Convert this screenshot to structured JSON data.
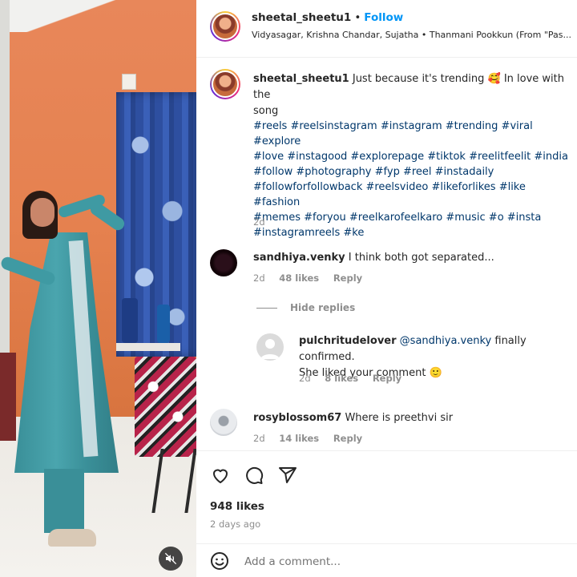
{
  "post": {
    "author": "sheetal_sheetu1",
    "follow_label": "Follow",
    "audio": "Vidyasagar, Krishna Chandar, Sujatha • Thanmani Pookkun (From \"Pas..."
  },
  "caption": {
    "username": "sheetal_sheetu1",
    "text_line1": "Just because it's trending 🥰 In love with the",
    "text_line2": "song",
    "hashtags": [
      "#reels #reelsinstagram #instagram #trending #viral #explore",
      "#love #instagood #explorepage #tiktok #reelitfeelit #india",
      "#follow #photography #fyp #reel #instadaily",
      "#followforfollowback #reelsvideo #likeforlikes #like #fashion",
      "#memes #foryou #reelkarofeelkaro #music #o #insta",
      "#instagramreels #ke"
    ],
    "age": "2d"
  },
  "comments": [
    {
      "username": "sandhiya.venky",
      "text": "I think both got separated...",
      "age": "2d",
      "likes": "48 likes",
      "reply_label": "Reply",
      "hide_replies_label": "Hide replies",
      "replies": [
        {
          "username": "pulchritudelover",
          "mention": "@sandhiya.venky",
          "text_line1": "finally confirmed.",
          "text_line2": "She liked your comment 🙂",
          "age": "2d",
          "likes": "8 likes",
          "reply_label": "Reply"
        }
      ]
    },
    {
      "username": "rosyblossom67",
      "text": "Where is preethvi sir",
      "age": "2d",
      "likes": "14 likes",
      "reply_label": "Reply"
    }
  ],
  "actions": {
    "like_icon": "heart-icon",
    "comment_icon": "comment-icon",
    "share_icon": "send-icon"
  },
  "stats": {
    "likes": "948 likes",
    "posted": "2 days ago"
  },
  "add_comment": {
    "placeholder": "Add a comment..."
  },
  "colors": {
    "link": "#00376b",
    "follow": "#0095f6",
    "muted": "#8e8e8e"
  }
}
